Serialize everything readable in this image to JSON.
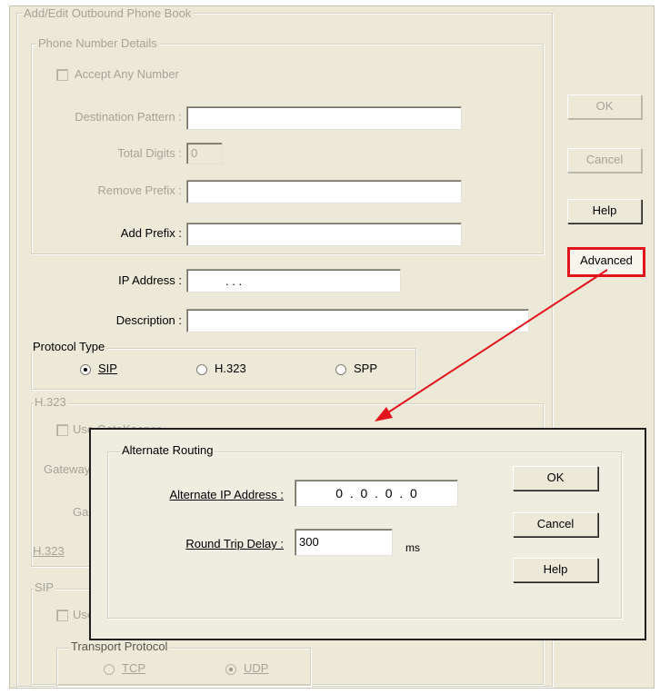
{
  "dialog": {
    "title": "Add/Edit Outbound Phone Book",
    "buttons": {
      "ok": "OK",
      "cancel": "Cancel",
      "help": "Help",
      "advanced": "Advanced"
    }
  },
  "phone_number_details": {
    "legend": "Phone Number Details",
    "accept_any_number": "Accept Any Number",
    "destination_pattern_label": "Destination Pattern :",
    "destination_pattern_value": "",
    "total_digits_label": "Total Digits :",
    "total_digits_value": "0",
    "remove_prefix_label": "Remove Prefix :",
    "remove_prefix_value": "",
    "add_prefix_label": "Add Prefix :",
    "add_prefix_value": ""
  },
  "ip_address": {
    "label": "IP Address :",
    "value": ".         .         ."
  },
  "description": {
    "label": "Description :",
    "value": ""
  },
  "protocol_type": {
    "legend": "Protocol Type",
    "options": [
      "SIP",
      "H.323",
      "SPP"
    ],
    "selected": "SIP"
  },
  "h323": {
    "legend": "H.323",
    "use_gatekeeper": "Use GateKeeper",
    "gateway_label": "Gateway",
    "ga_label": "Ga",
    "h323_label": "H.323"
  },
  "sip": {
    "legend": "SIP",
    "use_proxy": "Use Proxy",
    "transport_legend": "Transport Protocol",
    "transport_options": [
      "TCP",
      "UDP"
    ],
    "transport_selected": "UDP"
  },
  "alternate_routing": {
    "legend": "Alternate Routing",
    "alt_ip_label": "Alternate IP Address :",
    "alt_ip_value": "0  .  0  .  0  .  0",
    "rtd_label": "Round Trip Delay :",
    "rtd_value": "300",
    "rtd_unit": "ms",
    "buttons": {
      "ok": "OK",
      "cancel": "Cancel",
      "help": "Help"
    }
  },
  "annotation": {
    "color": "#e2141c"
  }
}
